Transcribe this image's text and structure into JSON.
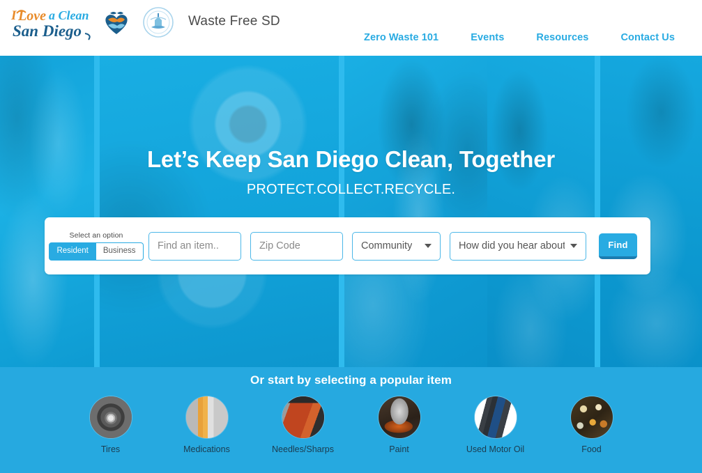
{
  "header": {
    "logo_alt": "I Love a Clean San Diego",
    "heart_icon": "heart-wave-icon",
    "seal_icon": "city-of-san-diego-seal-icon",
    "site_title": "Waste Free SD",
    "nav": [
      {
        "label": "Zero Waste 101"
      },
      {
        "label": "Events"
      },
      {
        "label": "Resources"
      },
      {
        "label": "Contact Us"
      }
    ]
  },
  "hero": {
    "title": "Let’s Keep San Diego Clean, Together",
    "subtitle": "PROTECT.COLLECT.RECYCLE."
  },
  "search": {
    "toggle_label": "Select an option",
    "toggle_resident": "Resident",
    "toggle_business": "Business",
    "item_placeholder": "Find an item..",
    "item_value": "",
    "zip_placeholder": "Zip Code",
    "zip_value": "",
    "community_selected": "Community",
    "how_hear_selected": "How did you hear about",
    "find_label": "Find"
  },
  "popular": {
    "title": "Or start by selecting a popular item",
    "items": [
      {
        "label": "Tires",
        "image": "tires"
      },
      {
        "label": "Medications",
        "image": "medications"
      },
      {
        "label": "Needles/Sharps",
        "image": "needles"
      },
      {
        "label": "Paint",
        "image": "paint"
      },
      {
        "label": "Used Motor Oil",
        "image": "motoroil"
      },
      {
        "label": "Food",
        "image": "food"
      }
    ]
  },
  "colors": {
    "brand_blue": "#29ABE2",
    "hero_overlay": "#12A3DA",
    "popular_bg": "#26A9E0",
    "nav_link": "#29ABE2",
    "find_button": "#29ABE2",
    "find_button_shadow": "#1B7CB0"
  }
}
